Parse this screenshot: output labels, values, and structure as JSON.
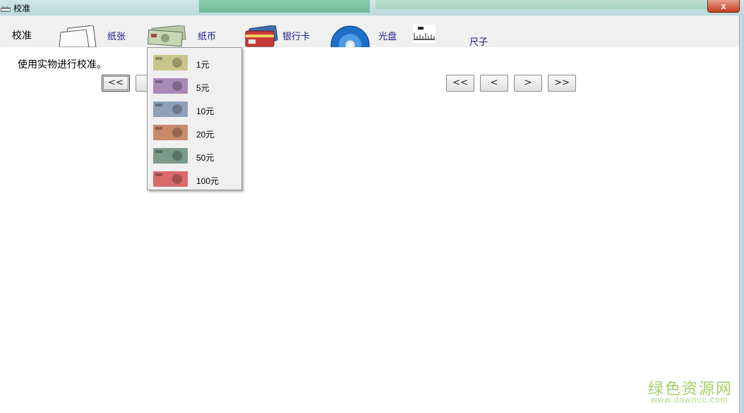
{
  "window": {
    "title": "校准",
    "close_glyph": "x"
  },
  "toolbar": {
    "main_label": "校准",
    "tools": [
      {
        "label": "纸张",
        "icon": "paper-icon"
      },
      {
        "label": "纸币",
        "icon": "banknote-icon"
      },
      {
        "label": "银行卡",
        "icon": "bank-card-icon"
      },
      {
        "label": "光盘",
        "icon": "disc-icon"
      },
      {
        "label": "尺子",
        "icon": "ruler-icon"
      }
    ]
  },
  "main": {
    "instruction": "使用实物进行校准。",
    "nav_left": [
      "<<",
      "<"
    ],
    "nav_right": [
      "<<",
      "<",
      ">",
      ">>"
    ]
  },
  "dropdown": {
    "items": [
      {
        "label": "1元",
        "color": "#c9c48a"
      },
      {
        "label": "5元",
        "color": "#a88ab8"
      },
      {
        "label": "10元",
        "color": "#8fa0b8"
      },
      {
        "label": "20元",
        "color": "#c98a6a"
      },
      {
        "label": "50元",
        "color": "#7a9a8a"
      },
      {
        "label": "100元",
        "color": "#d86a6a"
      }
    ]
  },
  "watermark": {
    "main": "绿色资源网",
    "sub": "www.downcc.com"
  }
}
